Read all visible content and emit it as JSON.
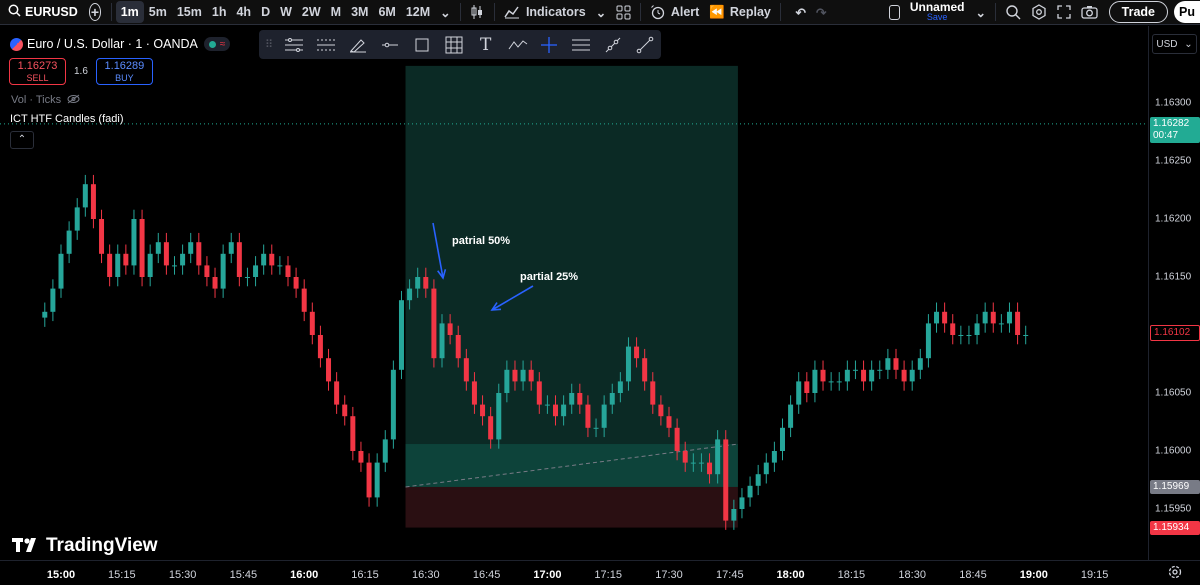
{
  "toolbar": {
    "symbol": "EURUSD",
    "intervals": [
      "1m",
      "5m",
      "15m",
      "1h",
      "4h",
      "D",
      "W",
      "2W",
      "M",
      "3M",
      "6M",
      "12M"
    ],
    "active_interval": "1m",
    "indicators_label": "Indicators",
    "alert_label": "Alert",
    "replay_label": "Replay",
    "layout_name": "Unnamed",
    "save_label": "Save",
    "trade_label": "Trade",
    "overflow_label": "Pu"
  },
  "legend": {
    "title": "Euro / U.S. Dollar · 1 · OANDA",
    "sell_price": "1.16273",
    "sell_label": "SELL",
    "spread": "1.6",
    "buy_price": "1.16289",
    "buy_label": "BUY",
    "volume_label": "Vol · Ticks",
    "indicator_label": "ICT HTF Candles (fadi)"
  },
  "colors": {
    "up": "#26a69a",
    "down": "#f23645",
    "profit_zone": "#0b2a25",
    "loss_zone": "#2a0f12",
    "accent": "#2962ff"
  },
  "price_axis": {
    "currency": "USD",
    "ticks": [
      "1.16300",
      "1.16250",
      "1.16200",
      "1.16150",
      "1.16100",
      "1.16050",
      "1.16000",
      "1.15950"
    ],
    "labels": {
      "current_price": "1.16282",
      "countdown": "00:47",
      "last_price": "1.16102",
      "target_price": "1.15969",
      "stop_price": "1.15934"
    }
  },
  "time_axis": {
    "ticks": [
      {
        "label": "15:00",
        "bold": true
      },
      {
        "label": "15:15",
        "bold": false
      },
      {
        "label": "15:30",
        "bold": false
      },
      {
        "label": "15:45",
        "bold": false
      },
      {
        "label": "16:00",
        "bold": true
      },
      {
        "label": "16:15",
        "bold": false
      },
      {
        "label": "16:30",
        "bold": false
      },
      {
        "label": "16:45",
        "bold": false
      },
      {
        "label": "17:00",
        "bold": true
      },
      {
        "label": "17:15",
        "bold": false
      },
      {
        "label": "17:30",
        "bold": false
      },
      {
        "label": "17:45",
        "bold": false
      },
      {
        "label": "18:00",
        "bold": true
      },
      {
        "label": "18:15",
        "bold": false
      },
      {
        "label": "18:30",
        "bold": false
      },
      {
        "label": "18:45",
        "bold": false
      },
      {
        "label": "19:00",
        "bold": true
      },
      {
        "label": "19:15",
        "bold": false
      }
    ]
  },
  "annotations": {
    "partial_1": "patrial 50%",
    "partial_2": "partial 25%"
  },
  "branding": {
    "logo_text": "TradingView"
  },
  "chart_data": {
    "type": "candlestick",
    "ylim": [
      1.159,
      1.1635
    ],
    "x": [
      "14:56",
      "14:58",
      "15:00",
      "15:02",
      "15:04",
      "15:06",
      "15:08",
      "15:10",
      "15:12",
      "15:14",
      "15:16",
      "15:18",
      "15:20",
      "15:22",
      "15:24",
      "15:26",
      "15:28",
      "15:30",
      "15:32",
      "15:34",
      "15:36",
      "15:38",
      "15:40",
      "15:42",
      "15:44",
      "15:46",
      "15:48",
      "15:50",
      "15:52",
      "15:54",
      "15:56",
      "15:58",
      "16:00",
      "16:02",
      "16:04",
      "16:06",
      "16:08",
      "16:10",
      "16:12",
      "16:14",
      "16:16",
      "16:18",
      "16:20",
      "16:22",
      "16:24",
      "16:26",
      "16:28",
      "16:30",
      "16:32",
      "16:34",
      "16:36",
      "16:38",
      "16:40",
      "16:42",
      "16:44",
      "16:46",
      "16:48",
      "16:50",
      "16:52",
      "16:54",
      "16:56",
      "16:58",
      "17:00",
      "17:02",
      "17:04",
      "17:06",
      "17:08",
      "17:10",
      "17:12",
      "17:14",
      "17:16",
      "17:18",
      "17:20",
      "17:22",
      "17:24",
      "17:26",
      "17:28",
      "17:30",
      "17:32",
      "17:34",
      "17:36",
      "17:38",
      "17:40",
      "17:42",
      "17:44",
      "17:46",
      "17:48",
      "17:50",
      "17:52",
      "17:54",
      "17:56",
      "17:58",
      "18:00",
      "18:02",
      "18:04",
      "18:06",
      "18:08",
      "18:10",
      "18:12",
      "18:14",
      "18:16",
      "18:18",
      "18:20",
      "18:22",
      "18:24",
      "18:26",
      "18:28",
      "18:30",
      "18:32",
      "18:34",
      "18:36",
      "18:38",
      "18:40",
      "18:42",
      "18:44",
      "18:46",
      "18:48",
      "18:50",
      "18:52",
      "18:54",
      "18:56",
      "18:58",
      "19:00",
      "19:02",
      "19:04",
      "19:06",
      "19:08",
      "19:10",
      "19:12",
      "19:14",
      "19:16",
      "19:18",
      "19:20",
      "19:22",
      "19:24"
    ],
    "close": [
      1.1612,
      1.1614,
      1.1617,
      1.1619,
      1.1621,
      1.1623,
      1.162,
      1.1617,
      1.1615,
      1.1617,
      1.1616,
      1.162,
      1.1615,
      1.1617,
      1.1618,
      1.1616,
      1.1616,
      1.1617,
      1.1618,
      1.1616,
      1.1615,
      1.1614,
      1.1617,
      1.1618,
      1.1615,
      1.1615,
      1.1616,
      1.1617,
      1.1616,
      1.1616,
      1.1615,
      1.1614,
      1.1612,
      1.161,
      1.1608,
      1.1606,
      1.1604,
      1.1603,
      1.16,
      1.1599,
      1.1596,
      1.1599,
      1.1601,
      1.1607,
      1.1613,
      1.1614,
      1.1615,
      1.1614,
      1.1608,
      1.1611,
      1.161,
      1.1608,
      1.1606,
      1.1604,
      1.1603,
      1.1601,
      1.1605,
      1.1607,
      1.1606,
      1.1607,
      1.1606,
      1.1604,
      1.1604,
      1.1603,
      1.1604,
      1.1605,
      1.1604,
      1.1602,
      1.1602,
      1.1604,
      1.1605,
      1.1606,
      1.1609,
      1.1608,
      1.1606,
      1.1604,
      1.1603,
      1.1602,
      1.16,
      1.1599,
      1.1599,
      1.1599,
      1.1598,
      1.1601,
      1.1594,
      1.1595,
      1.1596,
      1.1597,
      1.1598,
      1.1599,
      1.16,
      1.1602,
      1.1604,
      1.1606,
      1.1605,
      1.1607,
      1.1606,
      1.1606,
      1.1606,
      1.1607,
      1.1607,
      1.1606,
      1.1607,
      1.1607,
      1.1608,
      1.1607,
      1.1606,
      1.1607,
      1.1608,
      1.1611,
      1.1612,
      1.1611,
      1.161,
      1.161,
      1.161,
      1.1611,
      1.1612,
      1.1611,
      1.1611,
      1.1612,
      1.161,
      1.161
    ]
  }
}
